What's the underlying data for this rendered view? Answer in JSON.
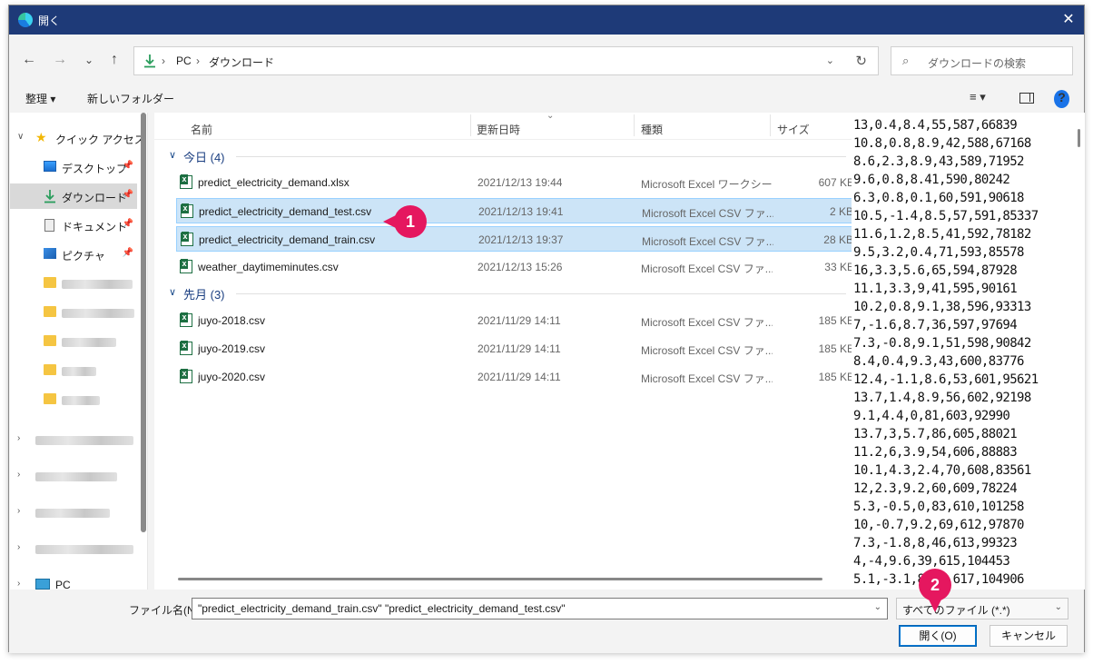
{
  "window": {
    "title": "開く",
    "close_glyph": "✕"
  },
  "nav": {
    "back": "←",
    "forward": "→",
    "recent": "⌄",
    "up": "↑",
    "breadcrumb": [
      "PC",
      "ダウンロード"
    ],
    "breadcrumb_sep": "›",
    "search_placeholder": "ダウンロードの検索"
  },
  "toolbar": {
    "organize": "整理 ▾",
    "new_folder": "新しいフォルダー",
    "view_glyph": "≡ ▾",
    "help": "?"
  },
  "sidebar": {
    "quick_access": "クイック アクセス",
    "items": [
      {
        "label": "デスクトップ",
        "icon": "desktop-icon",
        "pinned": true
      },
      {
        "label": "ダウンロード",
        "icon": "download-icon",
        "pinned": true,
        "selected": true
      },
      {
        "label": "ドキュメント",
        "icon": "document-icon",
        "pinned": true
      },
      {
        "label": "ピクチャ",
        "icon": "picture-icon",
        "pinned": true
      }
    ],
    "pc": "PC"
  },
  "columns": {
    "name": "名前",
    "date": "更新日時",
    "type": "種類",
    "size": "サイズ"
  },
  "groups": [
    {
      "label": "今日 (4)",
      "files": [
        {
          "name": "predict_electricity_demand.xlsx",
          "date": "2021/12/13 19:44",
          "type": "Microsoft Excel ワークシート",
          "size": "607 KB",
          "selected": false
        },
        {
          "name": "predict_electricity_demand_test.csv",
          "date": "2021/12/13 19:41",
          "type": "Microsoft Excel CSV ファ...",
          "size": "2 KB",
          "selected": true
        },
        {
          "name": "predict_electricity_demand_train.csv",
          "date": "2021/12/13 19:37",
          "type": "Microsoft Excel CSV ファ...",
          "size": "28 KB",
          "selected": true
        },
        {
          "name": "weather_daytimeminutes.csv",
          "date": "2021/12/13 15:26",
          "type": "Microsoft Excel CSV ファ...",
          "size": "33 KB",
          "selected": false
        }
      ]
    },
    {
      "label": "先月 (3)",
      "files": [
        {
          "name": "juyo-2018.csv",
          "date": "2021/11/29 14:11",
          "type": "Microsoft Excel CSV ファ...",
          "size": "185 KB",
          "selected": false
        },
        {
          "name": "juyo-2019.csv",
          "date": "2021/11/29 14:11",
          "type": "Microsoft Excel CSV ファ...",
          "size": "185 KB",
          "selected": false
        },
        {
          "name": "juyo-2020.csv",
          "date": "2021/11/29 14:11",
          "type": "Microsoft Excel CSV ファ...",
          "size": "185 KB",
          "selected": false
        }
      ]
    }
  ],
  "preview_lines": [
    "13,0.4,8.4,55,587,66839",
    "10.8,0.8,8.9,42,588,67168",
    "8.6,2.3,8.9,43,589,71952",
    "9.6,0.8,8.41,590,80242",
    "6.3,0.8,0.1,60,591,90618",
    "10.5,-1.4,8.5,57,591,85337",
    "11.6,1.2,8.5,41,592,78182",
    "9.5,3.2,0.4,71,593,85578",
    "16,3.3,5.6,65,594,87928",
    "11.1,3.3,9,41,595,90161",
    "10.2,0.8,9.1,38,596,93313",
    "7,-1.6,8.7,36,597,97694",
    "7.3,-0.8,9.1,51,598,90842",
    "8.4,0.4,9.3,43,600,83776",
    "12.4,-1.1,8.6,53,601,95621",
    "13.7,1.4,8.9,56,602,92198",
    "9.1,4.4,0,81,603,92990",
    "13.7,3,5.7,86,605,88021",
    "11.2,6,3.9,54,606,88883",
    "10.1,4.3,2.4,70,608,83561",
    "12,2.3,9.2,60,609,78224",
    "5.3,-0.5,0,83,610,101258",
    "10,-0.7,9.2,69,612,97870",
    "7.3,-1.8,8,46,613,99323",
    "4,-4,9.6,39,615,104453",
    "5.1,-3.1,8,39,617,104906"
  ],
  "footer": {
    "filename_label": "ファイル名(N):",
    "filename_value": "\"predict_electricity_demand_train.csv\" \"predict_electricity_demand_test.csv\"",
    "filter_value": "すべてのファイル (*.*)",
    "open_button": "開く(O)",
    "cancel_button": "キャンセル"
  },
  "annotations": {
    "step1": "1",
    "step2": "2",
    "color": "#e5175f"
  }
}
